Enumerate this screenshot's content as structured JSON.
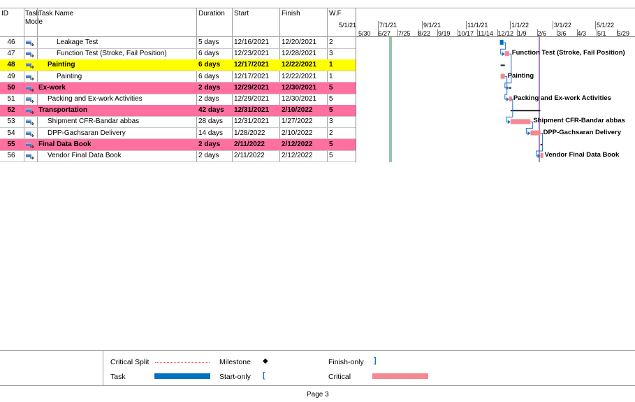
{
  "columns": {
    "id": "ID",
    "mode_line1": "Task",
    "mode_line2": "Mode",
    "name": "Task Name",
    "duration": "Duration",
    "start": "Start",
    "finish": "Finish",
    "wf": "W.F"
  },
  "timescale": {
    "top": [
      "5/1/21",
      "7/1/21",
      "9/1/21",
      "11/1/21",
      "1/1/22",
      "3/1/22",
      "5/1/22"
    ],
    "bottom": [
      "5/30",
      "6/27",
      "7/25",
      "8/22",
      "9/19",
      "10/17",
      "11/14",
      "12/12",
      "1/9",
      "2/6",
      "3/6",
      "4/3",
      "5/1",
      "5/29"
    ]
  },
  "tasks": [
    {
      "id": "46",
      "name": "Leakage Test",
      "duration": "5 days",
      "start": "12/16/2021",
      "finish": "12/20/2021",
      "wf": "2",
      "style": "normal",
      "indent": 3
    },
    {
      "id": "47",
      "name": "Function Test (Stroke, Fail Position)",
      "duration": "6 days",
      "start": "12/23/2021",
      "finish": "12/28/2021",
      "wf": "3",
      "style": "normal",
      "indent": 3
    },
    {
      "id": "48",
      "name": "Painting",
      "duration": "6 days",
      "start": "12/17/2021",
      "finish": "12/22/2021",
      "wf": "1",
      "style": "yellow",
      "indent": 2
    },
    {
      "id": "49",
      "name": "Painting",
      "duration": "6 days",
      "start": "12/17/2021",
      "finish": "12/22/2021",
      "wf": "1",
      "style": "normal",
      "indent": 3
    },
    {
      "id": "50",
      "name": "Ex-work",
      "duration": "2 days",
      "start": "12/29/2021",
      "finish": "12/30/2021",
      "wf": "5",
      "style": "pink",
      "indent": 1
    },
    {
      "id": "51",
      "name": "Packing and Ex-work Activities",
      "duration": "2 days",
      "start": "12/29/2021",
      "finish": "12/30/2021",
      "wf": "5",
      "style": "normal",
      "indent": 2
    },
    {
      "id": "52",
      "name": "Transportation",
      "duration": "42 days",
      "start": "12/31/2021",
      "finish": "2/10/2022",
      "wf": "5",
      "style": "pink",
      "indent": 1
    },
    {
      "id": "53",
      "name": "Shipment CFR-Bandar abbas",
      "duration": "28 days",
      "start": "12/31/2021",
      "finish": "1/27/2022",
      "wf": "3",
      "style": "normal",
      "indent": 2
    },
    {
      "id": "54",
      "name": "DPP-Gachsaran Delivery",
      "duration": "14 days",
      "start": "1/28/2022",
      "finish": "2/10/2022",
      "wf": "2",
      "style": "normal",
      "indent": 2
    },
    {
      "id": "55",
      "name": "Final Data Book",
      "duration": "2 days",
      "start": "2/11/2022",
      "finish": "2/12/2022",
      "wf": "5",
      "style": "pink",
      "indent": 1
    },
    {
      "id": "56",
      "name": "Vendor Final Data Book",
      "duration": "2 days",
      "start": "2/11/2022",
      "finish": "2/12/2022",
      "wf": "5",
      "style": "normal",
      "indent": 2
    }
  ],
  "gantt_labels": {
    "function_test": "Function Test (Stroke, Fail Position)",
    "painting": "Painting",
    "packing": "Packing and Ex-work Activities",
    "shipment": "Shipment CFR-Bandar abbas",
    "dpp": "DPP-Gachsaran Delivery",
    "vendor": "Vendor Final Data Book"
  },
  "legend": {
    "critical_split": "Critical Split",
    "task": "Task",
    "milestone": "Milestone",
    "start_only": "Start-only",
    "finish_only": "Finish-only",
    "critical": "Critical",
    "milestone_glyph": "◆",
    "start_only_glyph": "[",
    "finish_only_glyph": "]"
  },
  "footer": {
    "page": "Page 3"
  },
  "colors": {
    "task_bar": "#0070c0",
    "critical_bar": "#f4878f",
    "highlight_yellow": "#ffff00",
    "highlight_pink": "#ff6fa0",
    "link": "#1f6fbf"
  }
}
